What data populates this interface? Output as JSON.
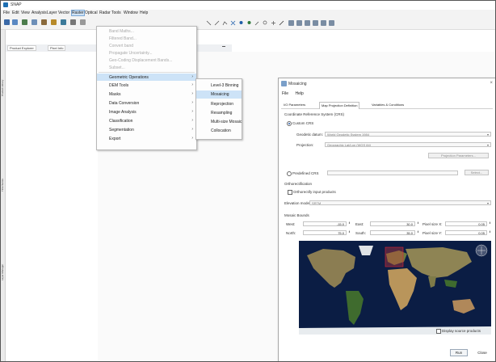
{
  "window": {
    "title": "SNAP"
  },
  "menubar": [
    "File",
    "Edit",
    "View",
    "Analysis",
    "Layer",
    "Vector",
    "Raster",
    "Optical",
    "Radar",
    "Tools",
    "Window",
    "Help"
  ],
  "tabs": [
    "Product Explorer",
    "Pixel Info"
  ],
  "side_tabs": [
    "Product Library",
    "Time Series",
    "Layer Manager"
  ],
  "raster_menu": {
    "items": [
      {
        "label": "Band Maths...",
        "disabled": true
      },
      {
        "label": "Filtered Band...",
        "disabled": true
      },
      {
        "label": "Convert band",
        "disabled": true
      },
      {
        "label": "Propagate Uncertainty...",
        "disabled": true
      },
      {
        "label": "Geo-Coding Displacement Bands...",
        "disabled": true
      },
      {
        "label": "Subset...",
        "disabled": true
      },
      {
        "label": "Geometric Operations",
        "submenu": true,
        "highlighted": true
      },
      {
        "label": "DEM Tools",
        "submenu": true
      },
      {
        "label": "Masks",
        "submenu": true
      },
      {
        "label": "Data Conversion",
        "submenu": true
      },
      {
        "label": "Image Analysis",
        "submenu": true
      },
      {
        "label": "Classification",
        "submenu": true
      },
      {
        "label": "Segmentation",
        "submenu": true
      },
      {
        "label": "Export",
        "submenu": true
      }
    ]
  },
  "geometric_submenu": {
    "items": [
      {
        "label": "Level-3 Binning"
      },
      {
        "label": "Mosaicing",
        "highlighted": true
      },
      {
        "label": "Reprojection"
      },
      {
        "label": "Resampling"
      },
      {
        "label": "Multi-size Mosaic"
      },
      {
        "label": "Collocation"
      }
    ]
  },
  "dialog": {
    "title": "Mosaicing",
    "menu": [
      "File",
      "Help"
    ],
    "tabs": [
      "I/O Parameters",
      "Map Projection Definition",
      "Variables & Conditions"
    ],
    "crs": {
      "section_title": "Coordinate Reference System (CRS)",
      "custom_label": "Custom CRS",
      "geodetic_label": "Geodetic datum:",
      "geodetic_value": "World Geodetic System 1984",
      "projection_label": "Projection:",
      "projection_value": "Geographic Lat/Lon (WGS 84)",
      "projection_params_label": "Projection Parameters...",
      "predefined_label": "Predefined CRS",
      "select_label": "Select..."
    },
    "ortho": {
      "section_title": "Orthorectification",
      "checkbox_label": "Orthorectify input products",
      "elevation_label": "Elevation model:",
      "elevation_value": "SRTM"
    },
    "bounds": {
      "section_title": "Mosaic Bounds",
      "west_label": "West:",
      "west_value": "-15.0",
      "east_label": "East:",
      "east_value": "30.0",
      "pixel_x_label": "Pixel size X:",
      "pixel_x_value": "0.05",
      "north_label": "North:",
      "north_value": "75.0",
      "south_label": "South:",
      "south_value": "35.0",
      "pixel_y_label": "Pixel size Y:",
      "pixel_y_value": "0.05"
    },
    "display_source_label": "Display source products",
    "run_label": "Run",
    "close_label": "Close"
  }
}
